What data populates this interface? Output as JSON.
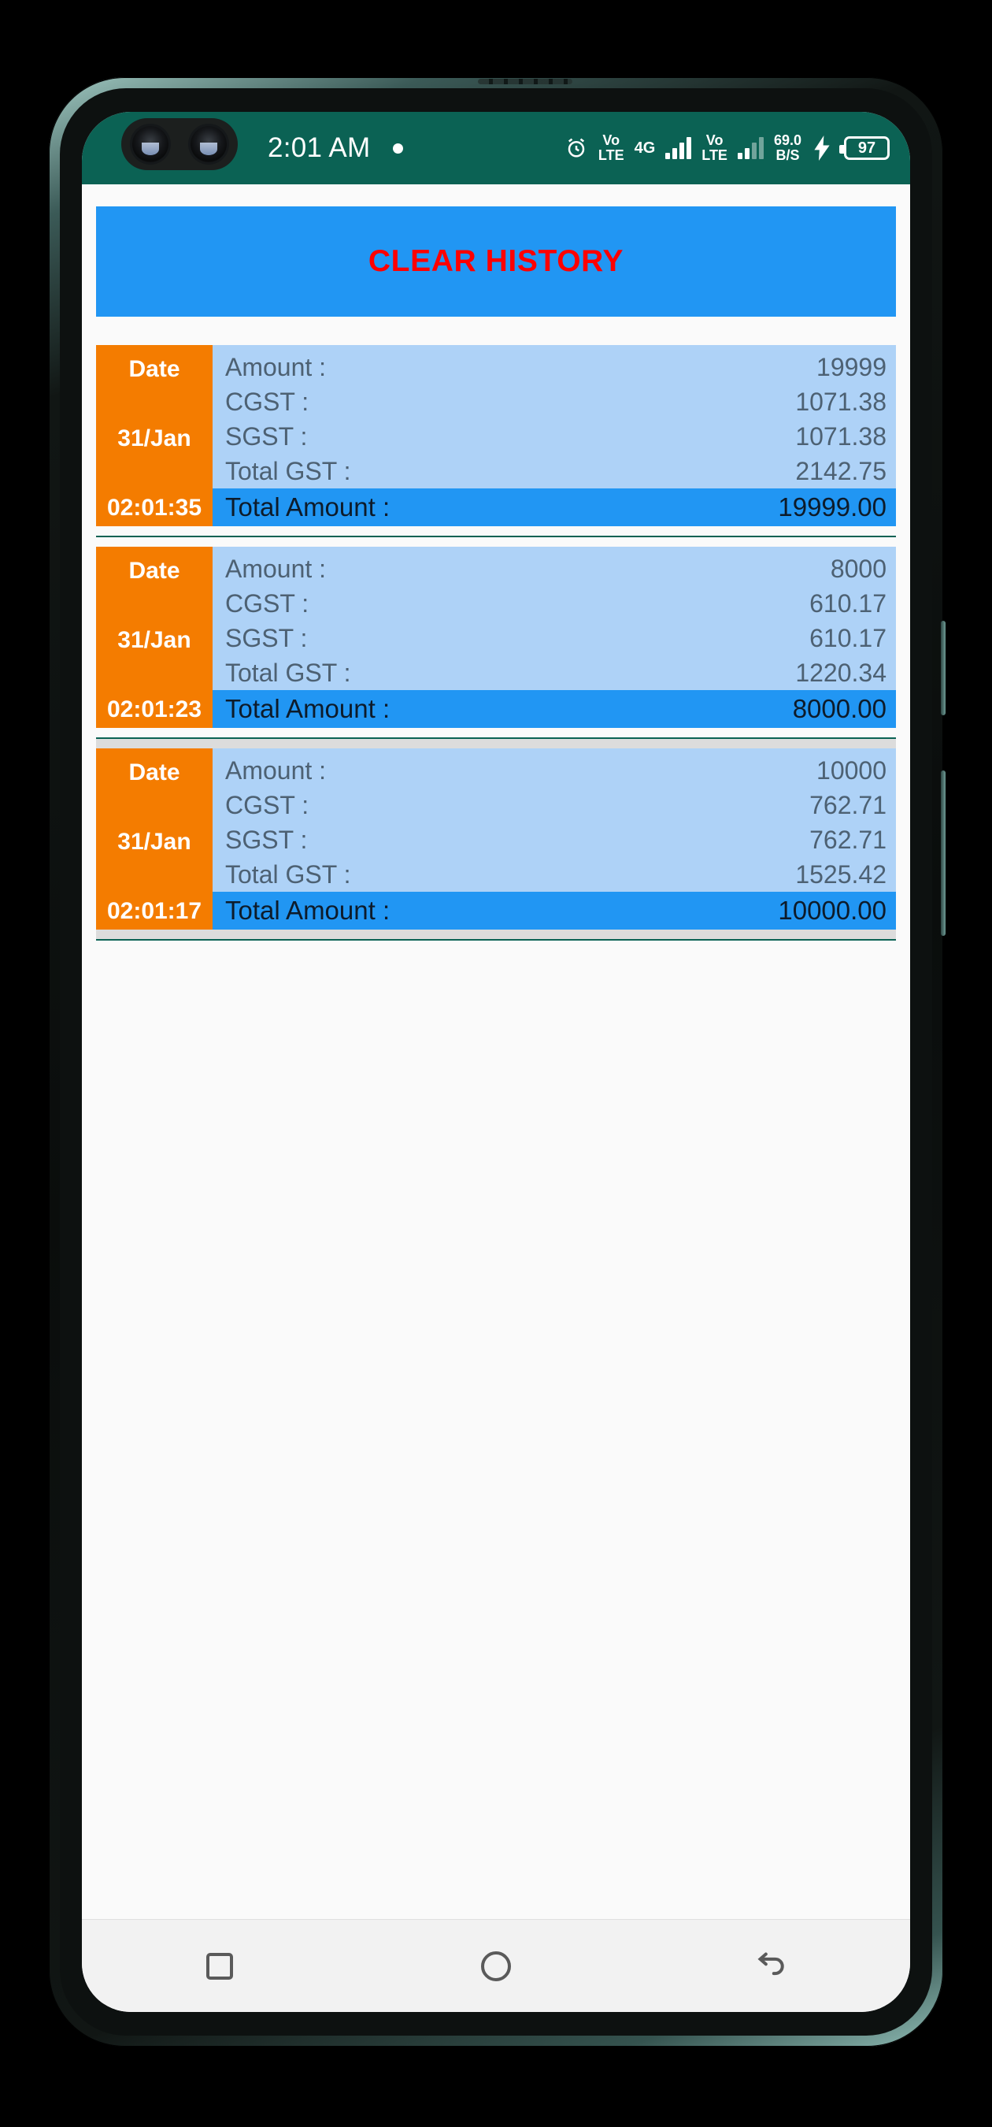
{
  "status_bar": {
    "time": "2:01 AM",
    "notification_dot": "•",
    "alarm_icon": "alarm-clock-icon",
    "sim1_network": "Vo LTE",
    "sim1_network_line1": "Vo",
    "sim1_network_line2": "LTE",
    "sim1_data_type": "4G",
    "sim2_network_line1": "Vo",
    "sim2_network_line2": "LTE",
    "data_speed_value": "69.0",
    "data_speed_unit": "B/S",
    "charging_icon": "charging-bolt-icon",
    "battery_level": "97",
    "background_color": "#0b6254"
  },
  "toolbar": {
    "clear_history_label": "CLEAR HISTORY",
    "button_color": "#2196f3",
    "text_color": "#ff0000"
  },
  "labels": {
    "date": "Date",
    "amount": "Amount :",
    "cgst": "CGST :",
    "sgst": "SGST :",
    "total_gst": "Total GST :",
    "total_amount": "Total Amount :"
  },
  "history": [
    {
      "date": "31/Jan",
      "time": "02:01:35",
      "amount": "19999",
      "cgst": "1071.38",
      "sgst": "1071.38",
      "total_gst": "2142.75",
      "total_amount": "19999.00",
      "highlighted": false
    },
    {
      "date": "31/Jan",
      "time": "02:01:23",
      "amount": "8000",
      "cgst": "610.17",
      "sgst": "610.17",
      "total_gst": "1220.34",
      "total_amount": "8000.00",
      "highlighted": false
    },
    {
      "date": "31/Jan",
      "time": "02:01:17",
      "amount": "10000",
      "cgst": "762.71",
      "sgst": "762.71",
      "total_gst": "1525.42",
      "total_amount": "10000.00",
      "highlighted": true
    }
  ],
  "nav_bar": {
    "recents_icon": "square-recents-icon",
    "home_icon": "circle-home-icon",
    "back_icon": "back-arrow-icon"
  },
  "colors": {
    "date_column": "#f47c00",
    "detail_background": "#aed2f7",
    "total_background": "#2196f3",
    "highlight_background": "#dcdcdc",
    "divider": "#0b6254"
  }
}
